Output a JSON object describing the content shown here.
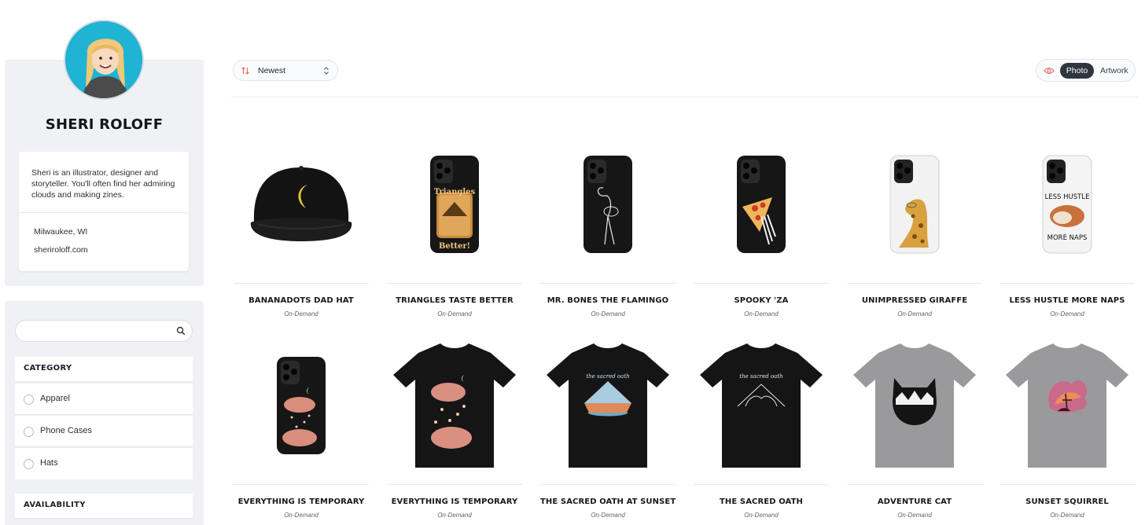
{
  "profile": {
    "name": "SHERI ROLOFF",
    "bio": "Sheri is an illustrator, designer and storyteller. You'll often find her admiring clouds and making zines.",
    "location": "Milwaukee, WI",
    "website": "sheriroloff.com"
  },
  "search": {
    "placeholder": "",
    "value": ""
  },
  "filters": {
    "category_title": "CATEGORY",
    "category_options": [
      "Apparel",
      "Phone Cases",
      "Hats"
    ],
    "availability_title": "AVAILABILITY"
  },
  "toolbar": {
    "sort_selected": "Newest",
    "view_photo": "Photo",
    "view_artwork": "Artwork",
    "active_view": "Photo"
  },
  "products": [
    {
      "title": "BANANADOTS DAD HAT",
      "availability": "On-Demand",
      "kind": "hat"
    },
    {
      "title": "TRIANGLES TASTE BETTER",
      "availability": "On-Demand",
      "kind": "phone-case"
    },
    {
      "title": "MR. BONES THE FLAMINGO",
      "availability": "On-Demand",
      "kind": "phone-case"
    },
    {
      "title": "SPOOKY 'ZA",
      "availability": "On-Demand",
      "kind": "phone-case"
    },
    {
      "title": "UNIMPRESSED GIRAFFE",
      "availability": "On-Demand",
      "kind": "phone-case"
    },
    {
      "title": "LESS HUSTLE MORE NAPS",
      "availability": "On-Demand",
      "kind": "phone-case"
    },
    {
      "title": "EVERYTHING IS TEMPORARY",
      "availability": "On-Demand",
      "kind": "phone-case"
    },
    {
      "title": "EVERYTHING IS TEMPORARY",
      "availability": "On-Demand",
      "kind": "t-shirt"
    },
    {
      "title": "THE SACRED OATH AT SUNSET",
      "availability": "On-Demand",
      "kind": "t-shirt"
    },
    {
      "title": "THE SACRED OATH",
      "availability": "On-Demand",
      "kind": "t-shirt"
    },
    {
      "title": "ADVENTURE CAT",
      "availability": "On-Demand",
      "kind": "t-shirt"
    },
    {
      "title": "SUNSET SQUIRREL",
      "availability": "On-Demand",
      "kind": "t-shirt"
    }
  ],
  "artwork_text": {
    "triangles_top": "Triangles",
    "triangles_bottom": "Better!",
    "naps_top": "LESS HUSTLE",
    "naps_bottom": "MORE NAPS",
    "oath_script": "the sacred oath"
  },
  "colors": {
    "sidebar_bg": "#eff1f5",
    "active_toggle": "#2f3541",
    "accent_icon": "#e8685a"
  },
  "icons": {
    "search": "search-icon",
    "sort": "sort-arrows-icon",
    "select_chevron": "chevron-updown-icon",
    "view": "eye-icon"
  }
}
